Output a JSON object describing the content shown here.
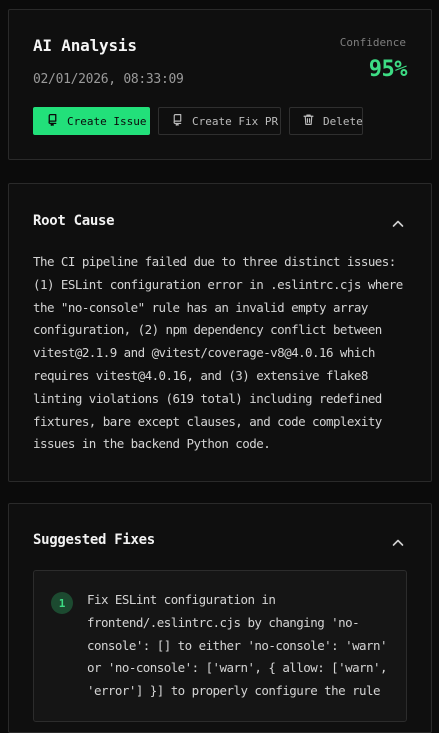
{
  "analysis": {
    "title": "AI Analysis",
    "timestamp": "02/01/2026, 08:33:09",
    "confidence_label": "Confidence",
    "confidence_value": "95%",
    "actions": {
      "create_issue": "Create Issue",
      "create_fix_pr": "Create Fix PR",
      "delete": "Delete"
    }
  },
  "root_cause": {
    "title": "Root Cause",
    "text": "The CI pipeline failed due to three distinct issues: (1) ESLint configuration error in .eslintrc.cjs where the \"no-console\" rule has an invalid empty array configuration, (2) npm dependency conflict between vitest@2.1.9 and @vitest/coverage-v8@4.0.16 which requires vitest@4.0.16, and (3) extensive flake8 linting violations (619 total) including redefined fixtures, bare except clauses, and code complexity issues in the backend Python code."
  },
  "suggested_fixes": {
    "title": "Suggested Fixes",
    "items": [
      {
        "number": "1",
        "text": "Fix ESLint configuration in frontend/.eslintrc.cjs by changing 'no-console': [] to either 'no-console': 'warn' or 'no-console': ['warn', { allow: ['warn', 'error'] }] to properly configure the rule"
      }
    ]
  },
  "icons": {
    "create_issue": "git-pull-request-icon",
    "create_fix_pr": "git-pull-request-icon",
    "delete": "trash-icon",
    "collapse": "chevron-up-icon"
  },
  "colors": {
    "accent": "#22e07a",
    "confidence": "#3ddc84",
    "background": "#0b0b0b",
    "card": "#0f0f0f",
    "border": "#2a2a2a"
  }
}
